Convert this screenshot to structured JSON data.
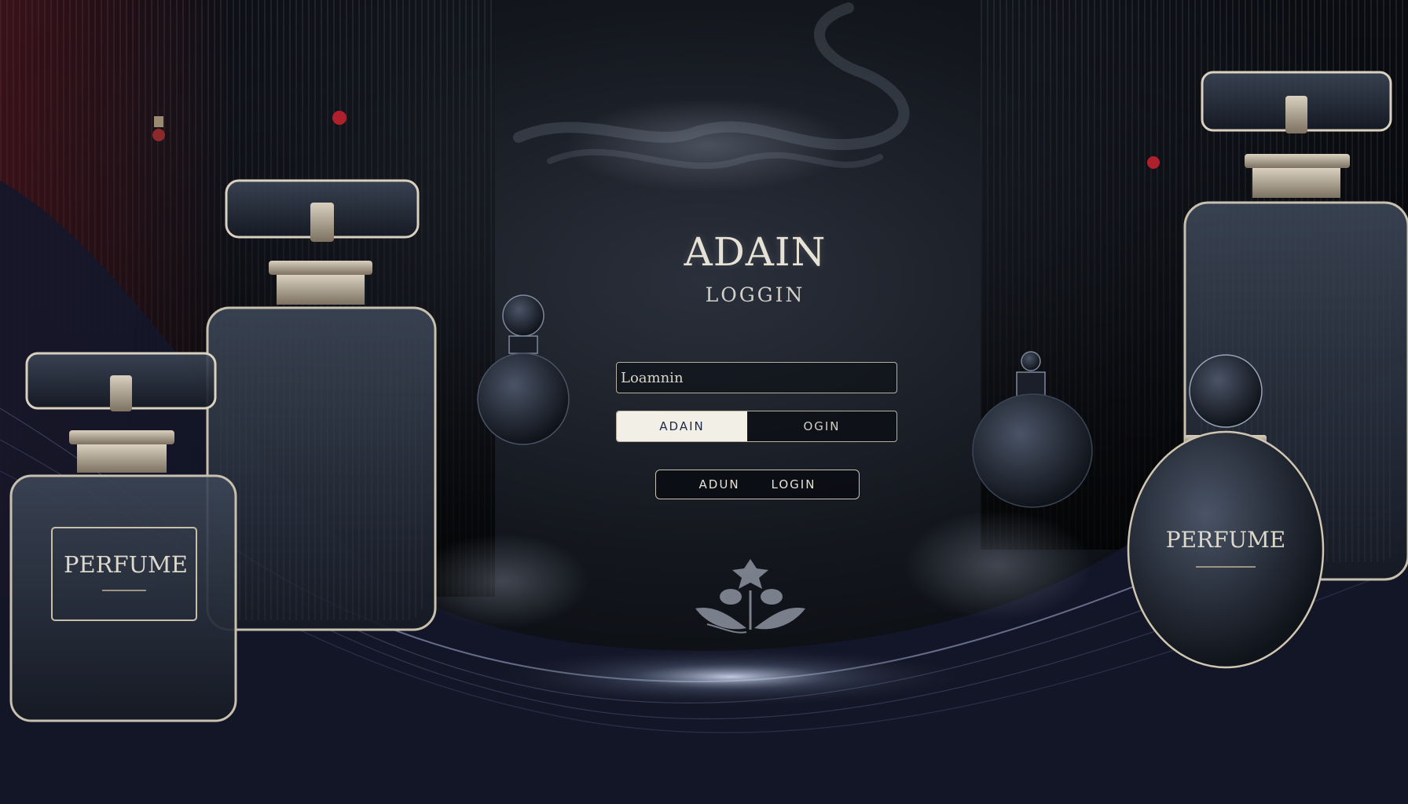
{
  "brand": {
    "title": "ADAIN",
    "subtitle": "LOGGIN"
  },
  "form": {
    "username_placeholder": "Loamnin",
    "toggle": {
      "active_label": "ADAIN",
      "inactive_label": "OGIN"
    },
    "submit": {
      "label_left": "ADUN",
      "label_right": "LOGIN"
    }
  },
  "decor": {
    "bottle_left_label": "PERFUME",
    "bottle_right_label": "PERFUME"
  },
  "colors": {
    "background": "#0c0e13",
    "accent_cream": "#f2efe7",
    "accent_navy": "#1c2a4a",
    "outline_gold": "#b7b0a0",
    "bead_red": "#b0202c"
  },
  "icons": {
    "floral_emblem": "rose-emblem-icon"
  }
}
